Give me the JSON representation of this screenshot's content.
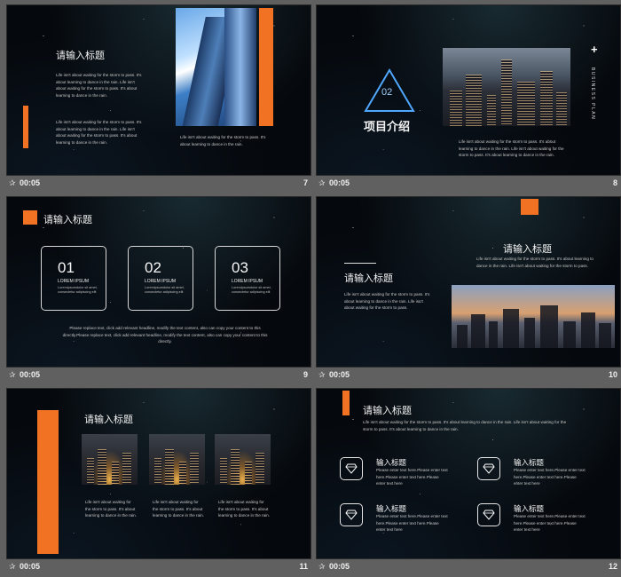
{
  "slides": [
    {
      "number": "7",
      "time": "00:05",
      "title": "请输入标题",
      "text_a": "Life isn't about waiting for the storm to pass. It's about learning to dance in the rain. Life isn't about waiting for the storm to pass. It's about learning to dance in the rain.",
      "text_b": "Life isn't about waiting for the storm to pass. It's about learning to dance in the rain. Life isn't about waiting for the storm to pass. It's about learning to dance in the rain.",
      "text_c": "Life isn't about waiting for the storm to pass. It's about learning to dance in the rain."
    },
    {
      "number": "8",
      "time": "00:05",
      "section_number": "02",
      "title": "项目介绍",
      "vertical_label": "BUSINESS PLAN",
      "plus": "+",
      "text": "Life isn't about waiting for the storm to pass. It's about learning to dance in the rain. Life isn't about waiting for the storm to pass. It's about learning to dance in the rain."
    },
    {
      "number": "9",
      "time": "00:05",
      "title": "请输入标题",
      "items": [
        {
          "num": "01",
          "label": "LOREM IPSUM",
          "desc": "Loremipsumdolor sit amet, consectetur adipiscing elit"
        },
        {
          "num": "02",
          "label": "LOREM IPSUM",
          "desc": "Loremipsumdolor sit amet, consectetur adipiscing elit"
        },
        {
          "num": "03",
          "label": "LOREM IPSUM",
          "desc": "Loremipsumdolor sit amet, consectetur adipiscing elit"
        }
      ],
      "text": "Please replace text, click add relevant headline, modify the text content, also can copy your content to this directly.Please replace text, click add relevant headline, modify the text content, also can copy your content to this directly."
    },
    {
      "number": "10",
      "time": "00:05",
      "title_right": "请输入标题",
      "title_left": "请输入标题",
      "text_right": "Life isn't about waiting for the storm to pass. It's about learning to dance in the rain. Life isn't about waiting for the storm to pass.",
      "text_left": "Life isn't about waiting for the storm to pass. It's about learning to dance in the rain. Life isn't about waiting for the storm to pass."
    },
    {
      "number": "11",
      "time": "00:05",
      "title": "请输入标题",
      "captions": [
        "Life isn't about waiting for the storm to pass. It's about learning to dance in the rain.",
        "Life isn't about waiting for the storm to pass. It's about learning to dance in the rain.",
        "Life isn't about waiting for the storm to pass. It's about learning to dance in the rain."
      ]
    },
    {
      "number": "12",
      "time": "00:05",
      "title": "请输入标题",
      "text": "Life isn't about waiting for the storm to pass. It's about learning to dance in the rain. Life isn't about waiting for the storm to pass. It's about learning to dance in the rain.",
      "items": [
        {
          "title": "输入标题",
          "desc": "Please enter text here.Please enter text here.Please enter text here.Please enter text here"
        },
        {
          "title": "输入标题",
          "desc": "Please enter text here.Please enter text here.Please enter text here.Please enter text here"
        },
        {
          "title": "输入标题",
          "desc": "Please enter text here.Please enter text here.Please enter text here.Please enter text here"
        },
        {
          "title": "输入标题",
          "desc": "Please enter text here.Please enter text here.Please enter text here.Please enter text here"
        }
      ]
    }
  ],
  "colors": {
    "accent": "#f07222",
    "background": "#05080c",
    "grid_bg": "#606060"
  },
  "icons": {
    "footer_icon": "star-icon",
    "item_icon": "diamond-icon"
  },
  "footer_star": "✰"
}
